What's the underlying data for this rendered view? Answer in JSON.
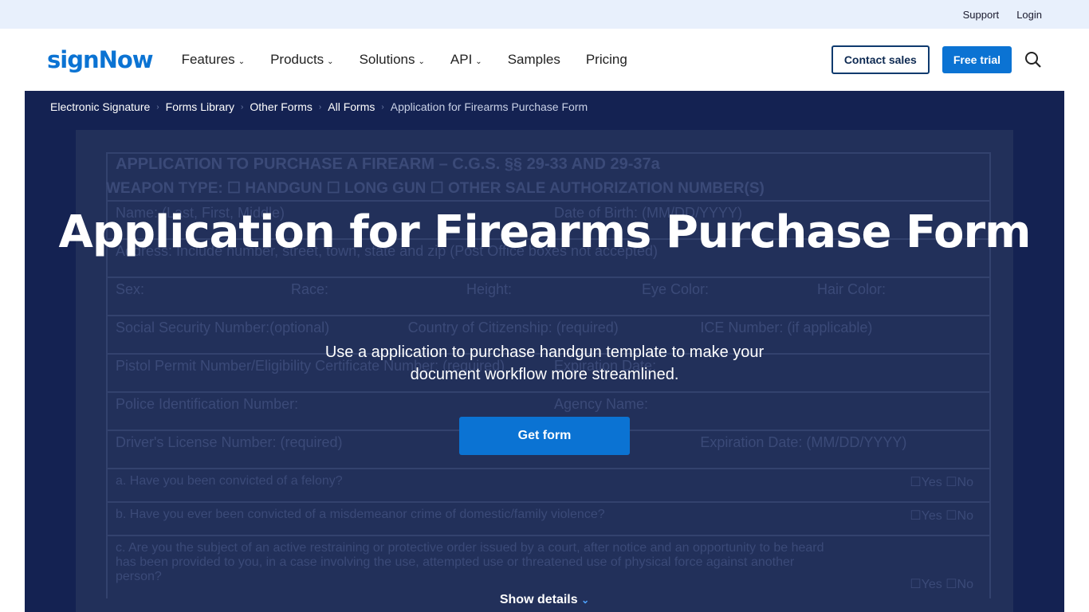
{
  "topbar": {
    "support": "Support",
    "login": "Login"
  },
  "nav": {
    "logo": "signNow",
    "items": [
      {
        "label": "Features",
        "chevron": true
      },
      {
        "label": "Products",
        "chevron": true
      },
      {
        "label": "Solutions",
        "chevron": true
      },
      {
        "label": "API",
        "chevron": true
      },
      {
        "label": "Samples"
      },
      {
        "label": "Pricing"
      }
    ],
    "contact_sales": "Contact sales",
    "free_trial": "Free trial",
    "search_icon": "search-icon"
  },
  "breadcrumb": [
    "Electronic Signature",
    "Forms Library",
    "Other Forms",
    "All Forms",
    "Application for Firearms Purchase Form"
  ],
  "hero": {
    "title": "Application for Firearms Purchase Form",
    "subtitle": "Use a application to purchase handgun template to make your document workflow more streamlined.",
    "cta": "Get form",
    "show_details": "Show details"
  },
  "form_preview": {
    "heading": "APPLICATION TO PURCHASE A FIREARM – C.G.S. §§ 29-33 AND 29-37a",
    "weapon": "WEAPON TYPE: ☐ HANDGUN ☐ LONG GUN ☐ OTHER   SALE AUTHORIZATION NUMBER(S)",
    "rows": [
      [
        "Name: (Last, First, Middle)",
        "Date of Birth: (MM/DD/YYYY)"
      ],
      [
        "Address: Include number, street, town, state and zip (Post Office boxes not accepted)"
      ],
      [
        "Sex:",
        "Race:",
        "Height:",
        "Eye Color:",
        "Hair Color:"
      ],
      [
        "Social Security Number:(optional)",
        "Country of Citizenship: (required)",
        "ICE Number: (if applicable)"
      ],
      [
        "Pistol Permit Number/Eligibility Certificate Number: (required)",
        "Expiration Date:"
      ],
      [
        "Police Identification Number:",
        "Agency Name:"
      ],
      [
        "Driver's License Number: (required)",
        "",
        "Expiration Date: (MM/DD/YYYY)"
      ]
    ],
    "questions": [
      "a. Have you been convicted of a felony?",
      "b. Have you ever been convicted of a misdemeanor crime of domestic/family violence?",
      "c. Are you the subject of an active restraining or protective order issued by a court, after notice and an opportunity to be heard has been provided to you, in a case involving the use, attempted use or threatened use of physical force against another person?"
    ],
    "yes_no": "☐Yes ☐No"
  },
  "colors": {
    "accent": "#0b73d3",
    "hero_bg": "#142252",
    "topbar": "#e8f0fc"
  }
}
